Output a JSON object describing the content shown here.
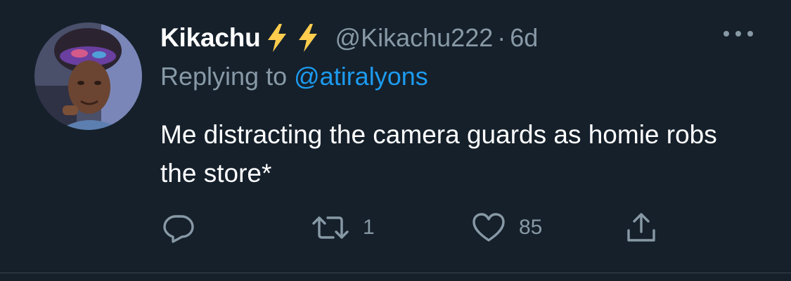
{
  "tweet": {
    "display_name": "Kikachu",
    "badges": [
      "lightning-icon",
      "lightning-icon"
    ],
    "handle": "@Kikachu222",
    "separator": "·",
    "time": "6d",
    "replying_prefix": "Replying to",
    "replying_handle": "@atiralyons",
    "text": "Me distracting the camera guards as homie robs the store*",
    "actions": {
      "reply": {
        "icon": "reply-icon",
        "count": ""
      },
      "retweet": {
        "icon": "retweet-icon",
        "count": "1"
      },
      "like": {
        "icon": "heart-icon",
        "count": "85"
      },
      "share": {
        "icon": "share-icon",
        "count": ""
      }
    }
  },
  "colors": {
    "background": "#15202b",
    "primary_text": "#ffffff",
    "secondary_text": "#8899a6",
    "link": "#1d9bf0",
    "bolt": "#ffcc4d",
    "divider": "#38444d"
  }
}
